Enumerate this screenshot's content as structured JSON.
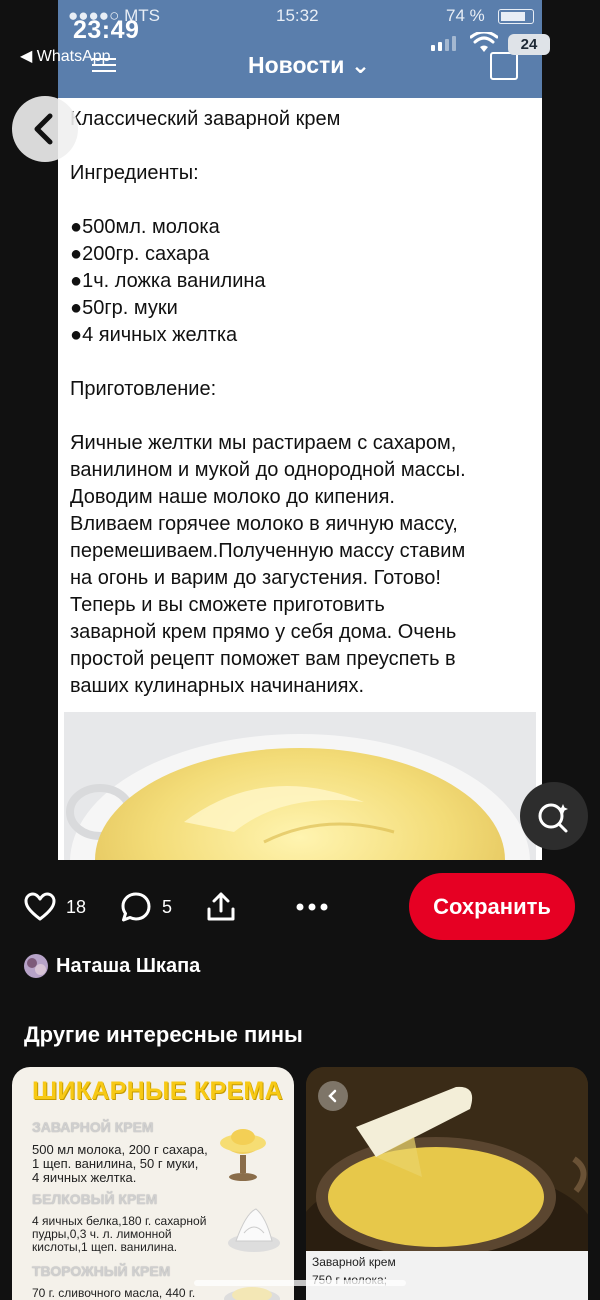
{
  "system": {
    "time": "23:49",
    "back_app": "◀ WhatsApp",
    "battery": "24"
  },
  "inner_screen": {
    "carrier": "●●●●○ MTS",
    "time": "15:32",
    "battery": "74 %",
    "title": "Новости ⌄"
  },
  "recipe": {
    "title": "Классический заварной крем",
    "ingredients_heading": "Ингредиенты:",
    "ingredients": [
      "●500мл. молока",
      "●200гр. сахара",
      "●1ч. ложка ванилина",
      "●50гр. муки",
      "●4 яичных желтка"
    ],
    "steps_heading": "Приготовление:",
    "steps_lines": [
      "Яичные желтки мы растираем с сахаром,",
      "ванилином и мукой до однородной массы.",
      "Доводим наше молоко до кипения.",
      "Вливаем горячее молоко в яичную массу,",
      "перемешиваем.Полученную массу ставим",
      "на огонь и варим до загустения. Готово!",
      "Теперь и вы сможете приготовить",
      "заварной крем прямо у себя дома. Очень",
      "простой рецепт поможет вам преуспеть в",
      "ваших кулинарных начинаниях."
    ]
  },
  "actions": {
    "likes": "18",
    "comments": "5",
    "save_label": "Сохранить"
  },
  "author": {
    "name": "Наташа Шкапа"
  },
  "more_section": {
    "title": "Другие интересные пины"
  },
  "pins": [
    {
      "title": "ШИКАРНЫЕ КРЕМА",
      "sections": [
        {
          "heading": "ЗАВАРНОЙ КРЕМ",
          "lines": [
            "500 мл молока, 200 г сахара,",
            "1 щеп. ванилина, 50 г муки,",
            "4 яичных желтка."
          ]
        },
        {
          "heading": "БЕЛКОВЫЙ КРЕМ",
          "lines": [
            "4 яичных белка,180 г. сахарной",
            "пудры,0,3 ч. л. лимонной",
            "кислоты,1 щеп. ванилина."
          ]
        },
        {
          "heading": "ТВОРОЖНЫЙ КРЕМ",
          "lines": [
            "70 г. сливочного масла, 440 г."
          ]
        }
      ]
    },
    {
      "caption_title": "Заварной крем",
      "caption_text": "750 г молока;"
    }
  ],
  "colors": {
    "save": "#e60023",
    "vk_bar": "#5a7eac",
    "pin_title": "#f7c915"
  }
}
